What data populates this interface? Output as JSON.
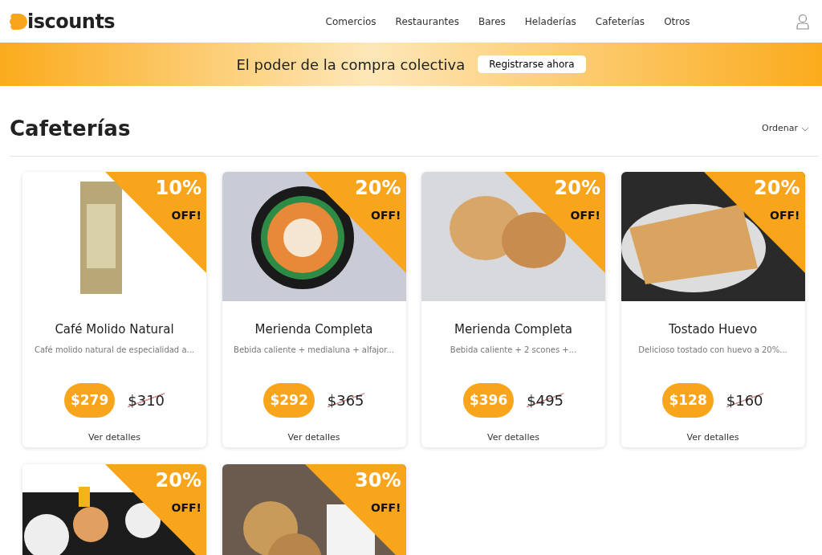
{
  "brand": {
    "text": "iscounts"
  },
  "nav": [
    {
      "label": "Comercios",
      "selected": false
    },
    {
      "label": "Restaurantes",
      "selected": false
    },
    {
      "label": "Bares",
      "selected": false
    },
    {
      "label": "Heladerías",
      "selected": false
    },
    {
      "label": "Cafeterías",
      "selected": false
    },
    {
      "label": "Otros",
      "selected": false
    }
  ],
  "banner": {
    "text": "El poder de la compra colectiva",
    "button": "Registrarse ahora"
  },
  "heading": "Cafeterías",
  "sort": {
    "label": "Ordenar"
  },
  "products": [
    {
      "discount": "10%",
      "off": "OFF!",
      "title": "Café Molido Natural",
      "description": "Café molido natural de especialidad a...",
      "price": "$279",
      "old_price": "$310",
      "link": "Ver detalles",
      "kind": "package"
    },
    {
      "discount": "20%",
      "off": "OFF!",
      "title": "Merienda Completa",
      "description": "Bebida caliente + medialuna + alfajor...",
      "price": "$292",
      "old_price": "$365",
      "link": "Ver detalles",
      "kind": "coffee"
    },
    {
      "discount": "20%",
      "off": "OFF!",
      "title": "Merienda Completa",
      "description": "Bebida caliente + 2 scones +...",
      "price": "$396",
      "old_price": "$495",
      "link": "Ver detalles",
      "kind": "scones"
    },
    {
      "discount": "20%",
      "off": "OFF!",
      "title": "Tostado Huevo",
      "description": "Delicioso tostado con huevo a 20%...",
      "price": "$128",
      "old_price": "$160",
      "link": "Ver detalles",
      "kind": "toast"
    },
    {
      "discount": "20%",
      "off": "OFF!",
      "kind": "table"
    },
    {
      "discount": "30%",
      "off": "OFF!",
      "kind": "cookies"
    }
  ]
}
